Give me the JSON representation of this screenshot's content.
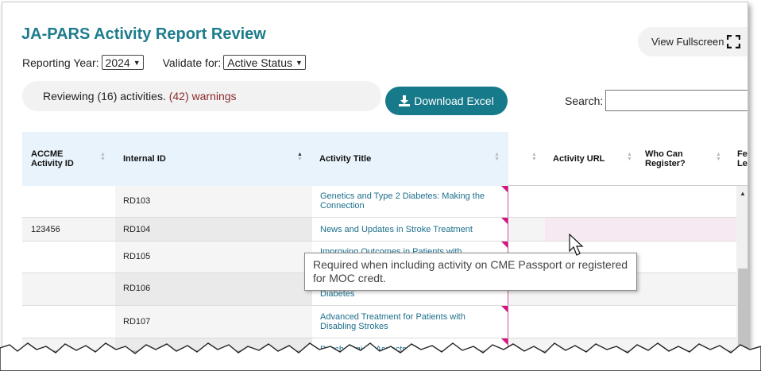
{
  "header": {
    "title": "JA-PARS Activity Report Review",
    "fullscreen_label": "View Fullscreen"
  },
  "filters": {
    "year_label": "Reporting Year:",
    "year_value": "2024",
    "validate_label": "Validate for:",
    "validate_value": "Active Status"
  },
  "summary": {
    "text": "Reviewing (16) activities.",
    "warnings": "(42) warnings"
  },
  "download": {
    "label": "Download Excel"
  },
  "search": {
    "label": "Search:",
    "value": ""
  },
  "table": {
    "columns": [
      {
        "label_line1": "ACCME",
        "label_line2": "Activity ID"
      },
      {
        "label_line1": "Internal ID",
        "label_line2": ""
      },
      {
        "label_line1": "Activity Title",
        "label_line2": ""
      },
      {
        "label_line1": "Activity URL",
        "label_line2": ""
      },
      {
        "label_line1": "Who Can",
        "label_line2": "Register?"
      },
      {
        "label_line1": "Fe",
        "label_line2": "Lea"
      }
    ],
    "rows": [
      {
        "accme_id": "",
        "internal_id": "RD103",
        "title": "Genetics and Type 2 Diabetes: Making the Connection"
      },
      {
        "accme_id": "123456",
        "internal_id": "RD104",
        "title": "News and Updates in Stroke Treatment"
      },
      {
        "accme_id": "",
        "internal_id": "RD105",
        "title": "Improving Outcomes in Patients with"
      },
      {
        "accme_id": "",
        "internal_id": "RD106",
        "title": "Diabetes"
      },
      {
        "accme_id": "",
        "internal_id": "RD107",
        "title": "Advanced Treatment for Patients with Disabling Strokes"
      },
      {
        "accme_id": "",
        "internal_id": "",
        "title": "Psychological Aspects of"
      }
    ]
  },
  "tooltip": {
    "text": "Required when including activity on CME Passport or registered for MOC credt."
  },
  "colors": {
    "accent": "#177a8a",
    "title": "#1d7c8c",
    "warning_text": "#8b2a2a",
    "warning_flag": "#d0177f",
    "header_bg": "#e8f3fb"
  }
}
